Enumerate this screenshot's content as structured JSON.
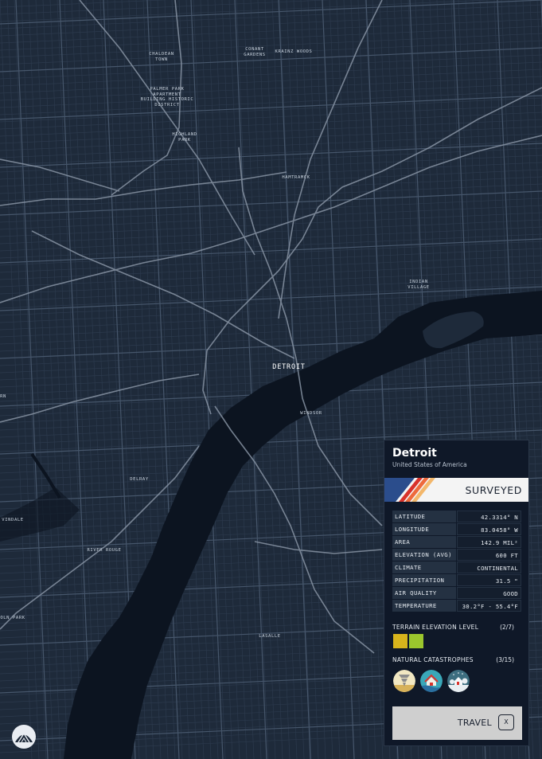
{
  "map": {
    "places": [
      {
        "id": "chaldean",
        "text": "CHALDEAN\nTOWN"
      },
      {
        "id": "conant",
        "text": "CONANT\nGARDENS"
      },
      {
        "id": "krainz",
        "text": "KRAINZ WOODS"
      },
      {
        "id": "palmer",
        "text": "PALMER PARK\nAPARTMENT\nBUILDING HISTORIC\nDISTRICT"
      },
      {
        "id": "highland",
        "text": "HIGHLAND\nPARK"
      },
      {
        "id": "hamtramck",
        "text": "HAMTRAMCK"
      },
      {
        "id": "indian",
        "text": "INDIAN\nVILLAGE"
      },
      {
        "id": "windsor",
        "text": "WINDSOR"
      },
      {
        "id": "delray",
        "text": "DELRAY"
      },
      {
        "id": "rn",
        "text": "RN"
      },
      {
        "id": "vindale",
        "text": "VINDALE"
      },
      {
        "id": "riverrouge",
        "text": "RIVER ROUGE"
      },
      {
        "id": "olnpark",
        "text": "OLN PARK"
      },
      {
        "id": "lasalle",
        "text": "LASALLE"
      }
    ],
    "city_label": "DETROIT",
    "colors": {
      "land": "#1e2a3a",
      "water": "#0c1420",
      "road": "#3a4a5e",
      "highway": "#8793a3"
    }
  },
  "logo_icon": "observatory-logo-icon",
  "panel": {
    "title": "Detroit",
    "subtitle": "United States of America",
    "status": "SURVEYED",
    "status_stripe_colors": [
      "#2b4d8c",
      "#d9322b",
      "#ee6a3c",
      "#f3b76b"
    ],
    "stats": [
      {
        "label": "LATITUDE",
        "value": "42.3314° N"
      },
      {
        "label": "LONGITUDE",
        "value": "83.0458° W"
      },
      {
        "label": "AREA",
        "value": "142.9 MIL²"
      },
      {
        "label": "ELEVATION (AVG)",
        "value": "600 FT"
      },
      {
        "label": "CLIMATE",
        "value": "CONTINENTAL"
      },
      {
        "label": "PRECIPITATION",
        "value": "31.5 \""
      },
      {
        "label": "AIR QUALITY",
        "value": "GOOD"
      },
      {
        "label": "TEMPERATURE",
        "value": "30.2°F - 55.4°F"
      }
    ],
    "terrain": {
      "label": "TERRAIN ELEVATION LEVEL",
      "count": "(2/7)",
      "swatch_colors": [
        "#d8b41c",
        "#9bc62d"
      ]
    },
    "catastrophes": {
      "label": "NATURAL CATASTROPHES",
      "count": "(3/15)",
      "icons": [
        "tornado-icon",
        "flood-icon",
        "blizzard-icon"
      ]
    },
    "travel": {
      "label": "TRAVEL",
      "key": "X"
    }
  }
}
